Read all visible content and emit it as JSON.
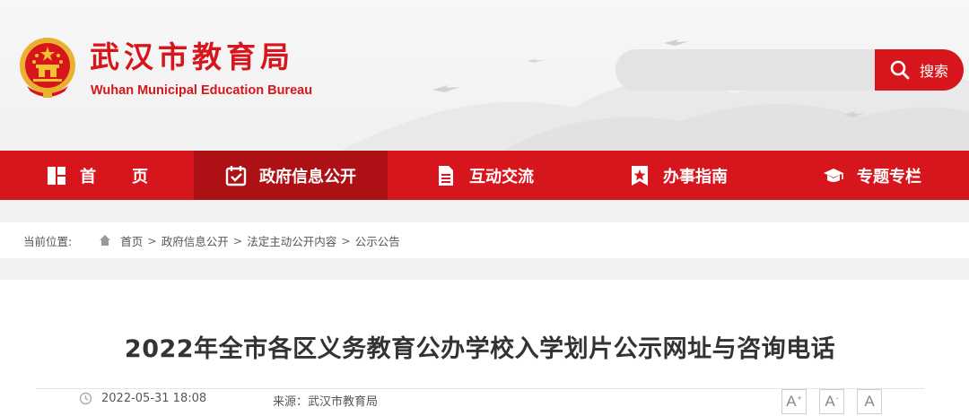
{
  "header": {
    "site_title": "武汉市教育局",
    "site_subtitle": "Wuhan Municipal Education Bureau",
    "emblem_icon": "national-emblem-icon",
    "search_placeholder": "",
    "search_button_label": "搜索",
    "brand_color": "#d6161c"
  },
  "nav": {
    "items": [
      {
        "label": "首页",
        "icon": "home-grid-icon",
        "active": false
      },
      {
        "label": "政府信息公开",
        "icon": "calendar-check-icon",
        "active": true
      },
      {
        "label": "互动交流",
        "icon": "document-icon",
        "active": false
      },
      {
        "label": "办事指南",
        "icon": "star-badge-icon",
        "active": false
      },
      {
        "label": "专题专栏",
        "icon": "graduation-cap-icon",
        "active": false
      }
    ]
  },
  "breadcrumb": {
    "label": "当前位置:",
    "items": [
      "首页",
      "政府信息公开",
      "法定主动公开内容",
      "公示公告"
    ],
    "separator": ">"
  },
  "article": {
    "title": "2022年全市各区义务教育公办学校入学划片公示网址与咨询电话",
    "date": "2022-05-31 18:08",
    "source": "来源：武汉市教育局",
    "font_size_buttons": [
      "A",
      "A",
      "A"
    ]
  }
}
